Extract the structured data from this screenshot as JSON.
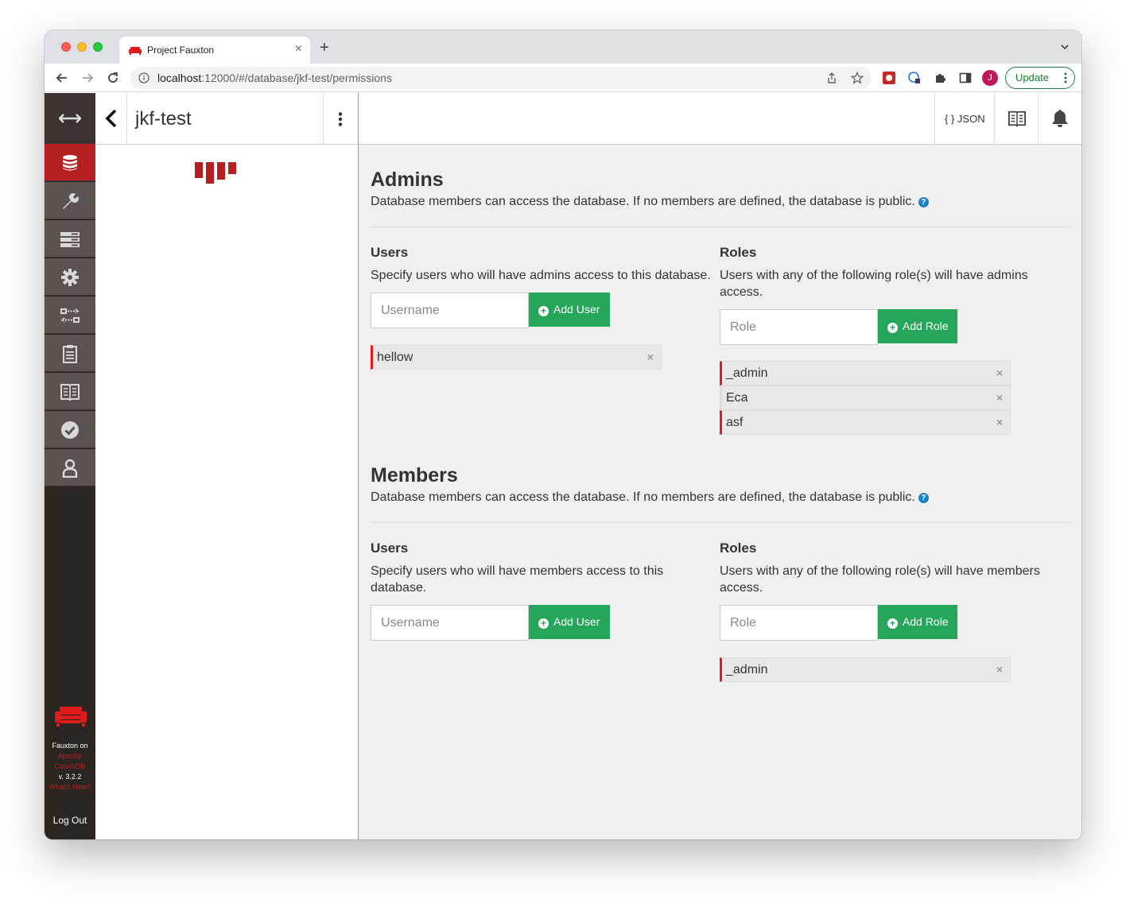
{
  "browser": {
    "tab_title": "Project Fauxton",
    "url_host": "localhost",
    "url_rest": ":12000/#/database/jkf-test/permissions",
    "profile_initial": "J",
    "update_label": "Update"
  },
  "sidebar": {
    "items": [
      {
        "name": "databases",
        "icon": "database-icon",
        "active": true
      },
      {
        "name": "setup",
        "icon": "wrench-icon"
      },
      {
        "name": "active-tasks",
        "icon": "tasks-icon"
      },
      {
        "name": "config",
        "icon": "gear-icon"
      },
      {
        "name": "replication",
        "icon": "replication-icon"
      },
      {
        "name": "log",
        "icon": "clipboard-icon"
      },
      {
        "name": "docs",
        "icon": "book-icon"
      },
      {
        "name": "verify",
        "icon": "check-circle-icon"
      },
      {
        "name": "user",
        "icon": "user-icon"
      }
    ],
    "footer_line1": "Fauxton on",
    "footer_link1": "Apache",
    "footer_link2": "CouchDB",
    "footer_version": "v. 3.2.2",
    "footer_whatsnew": "What's New?",
    "logout_label": "Log Out"
  },
  "db_header": {
    "name": "jkf-test"
  },
  "right_header": {
    "json_label": "{ } JSON"
  },
  "admins": {
    "title": "Admins",
    "description": "Database members can access the database. If no members are defined, the database is public.",
    "users_title": "Users",
    "users_desc": "Specify users who will have admins access to this database.",
    "username_placeholder": "Username",
    "add_user_label": "Add User",
    "users": [
      "hellow"
    ],
    "roles_title": "Roles",
    "roles_desc": "Users with any of the following role(s) will have admins access.",
    "role_placeholder": "Role",
    "add_role_label": "Add Role",
    "roles": [
      "_admin",
      "Eca",
      "asf"
    ]
  },
  "members": {
    "title": "Members",
    "description": "Database members can access the database. If no members are defined, the database is public.",
    "users_title": "Users",
    "users_desc": "Specify users who will have members access to this database.",
    "username_placeholder": "Username",
    "add_user_label": "Add User",
    "users": [],
    "roles_title": "Roles",
    "roles_desc": "Users with any of the following role(s) will have members access.",
    "role_placeholder": "Role",
    "add_role_label": "Add Role",
    "roles": [
      "_admin"
    ]
  },
  "colors": {
    "sidebar_bg": "#2b2522",
    "sidebar_item": "#5a5350",
    "active_red": "#b51f21",
    "add_green": "#26a65b",
    "help_blue": "#1a82c4"
  }
}
